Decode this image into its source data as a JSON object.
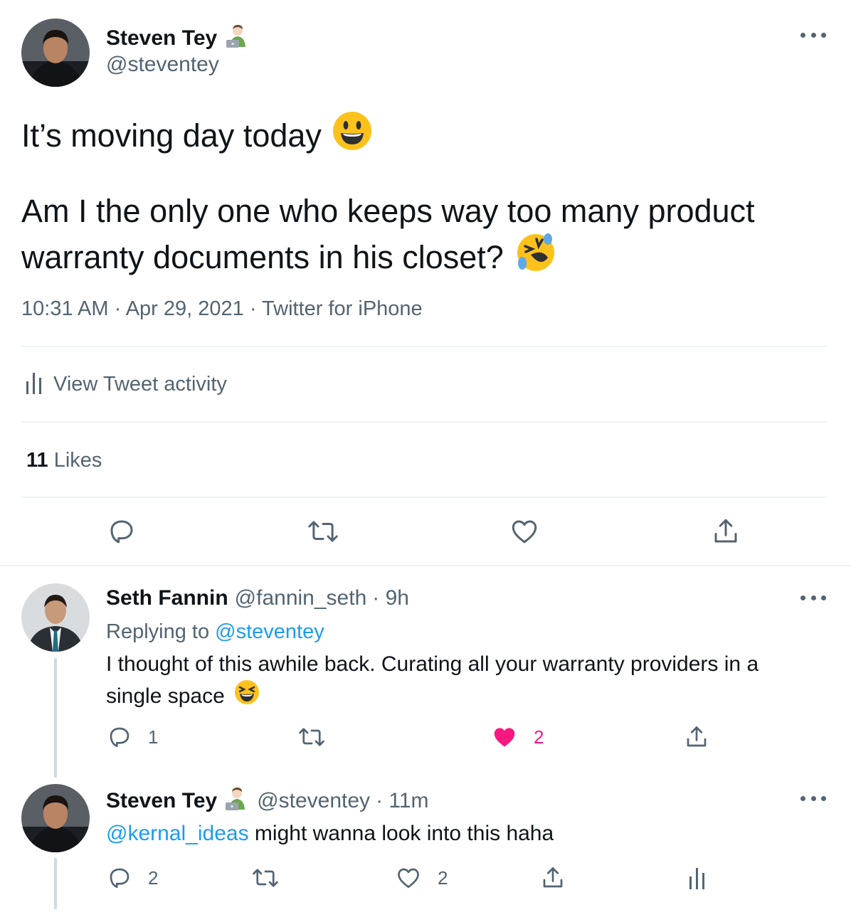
{
  "main_tweet": {
    "author_name": "Steven Tey",
    "author_handle": "@steventey",
    "line1": "It’s moving day today",
    "line2": "Am I the only one who keeps way too many product",
    "line3": "warranty documents in his closet?",
    "timestamp": "10:31 AM · Apr 29, 2021 · Twitter for iPhone",
    "activity_label": "View Tweet activity",
    "likes_count": "11",
    "likes_label": "Likes"
  },
  "reply1": {
    "author_name": "Seth Fannin",
    "author_handle": "@fannin_seth",
    "time": "· 9h",
    "replying_prefix": "Replying to",
    "replying_handle": "@steventey",
    "text_line1": "I thought of this awhile back. Curating all your warranty providers in a",
    "text_line2": "single space",
    "reply_count": "1",
    "like_count": "2",
    "liked": true
  },
  "reply2": {
    "author_name": "Steven Tey",
    "author_handle": "@steventey",
    "time": "· 11m",
    "mention": "@kernal_ideas",
    "text": " might wanna look into this haha",
    "reply_count": "2",
    "like_count": "2"
  },
  "colors": {
    "text": "#0f1419",
    "secondary": "#536471",
    "link": "#1d9bf0",
    "like": "#f91880",
    "divider": "#eff3f4"
  },
  "icons": [
    "more-icon",
    "reply-icon",
    "retweet-icon",
    "like-icon",
    "share-icon",
    "analytics-icon",
    "technologist-emoji",
    "smiley-emoji",
    "rofl-emoji",
    "laughing-emoji"
  ]
}
